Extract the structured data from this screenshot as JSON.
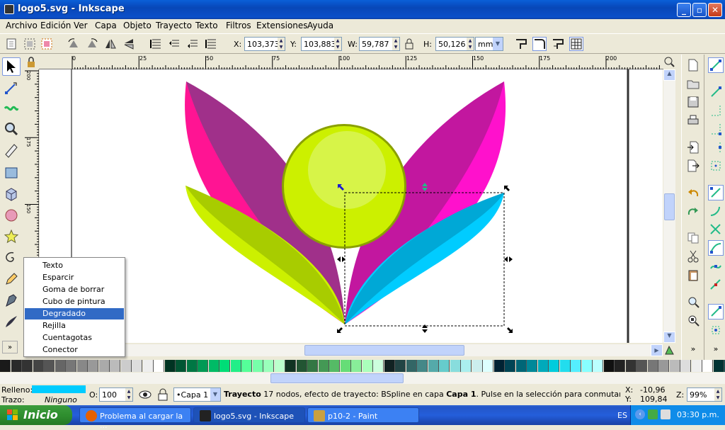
{
  "window": {
    "title": "logo5.svg - Inkscape"
  },
  "menu": [
    "Archivo",
    "Edición",
    "Ver",
    "Capa",
    "Objeto",
    "Trayecto",
    "Texto",
    "Filtros",
    "Extensiones",
    "Ayuda"
  ],
  "coords": {
    "x_label": "X:",
    "x": "103,373",
    "y_label": "Y:",
    "y": "103,883",
    "w_label": "W:",
    "w": "59,787",
    "h_label": "H:",
    "h": "50,126",
    "unit": "mm"
  },
  "ruler": {
    "h_ticks": [
      "0",
      "25",
      "50",
      "75",
      "100",
      "125",
      "150",
      "175",
      "200"
    ],
    "v_ticks": [
      "200",
      "175",
      "150",
      "125",
      "100"
    ]
  },
  "popup": {
    "items": [
      "Texto",
      "Esparcir",
      "Goma de borrar",
      "Cubo de pintura",
      "Degradado",
      "Rejilla",
      "Cuentagotas",
      "Conector"
    ],
    "highlighted": "Degradado"
  },
  "status": {
    "fill_label": "Relleno:",
    "fill_color": "#00ccff",
    "stroke_label": "Trazo:",
    "stroke_value": "Ninguno",
    "opacity_label": "O:",
    "opacity": "100",
    "layer": "•Capa 1",
    "message_bold": "Trayecto",
    "message": " 17 nodos, efecto de trayecto: BSpline en capa ",
    "message_layer": "Capa 1",
    "message_tail": ". Pulse en la selección para conmutar los tiradore...",
    "cursor_x_label": "X:",
    "cursor_x": "-10,96",
    "cursor_y_label": "Y:",
    "cursor_y": "109,84",
    "zoom_label": "Z:",
    "zoom": "99%"
  },
  "colors": {
    "accent": "#316ac5",
    "title": "#0a5fd8",
    "taskbar": "#245edb",
    "start": "#3c9d3c"
  },
  "taskbar": {
    "start": "Inicio",
    "tasks": [
      "Problema al cargar la ...",
      "logo5.svg - Inkscape",
      "p10-2 - Paint"
    ],
    "lang": "ES",
    "clock": "03:30 p.m."
  }
}
